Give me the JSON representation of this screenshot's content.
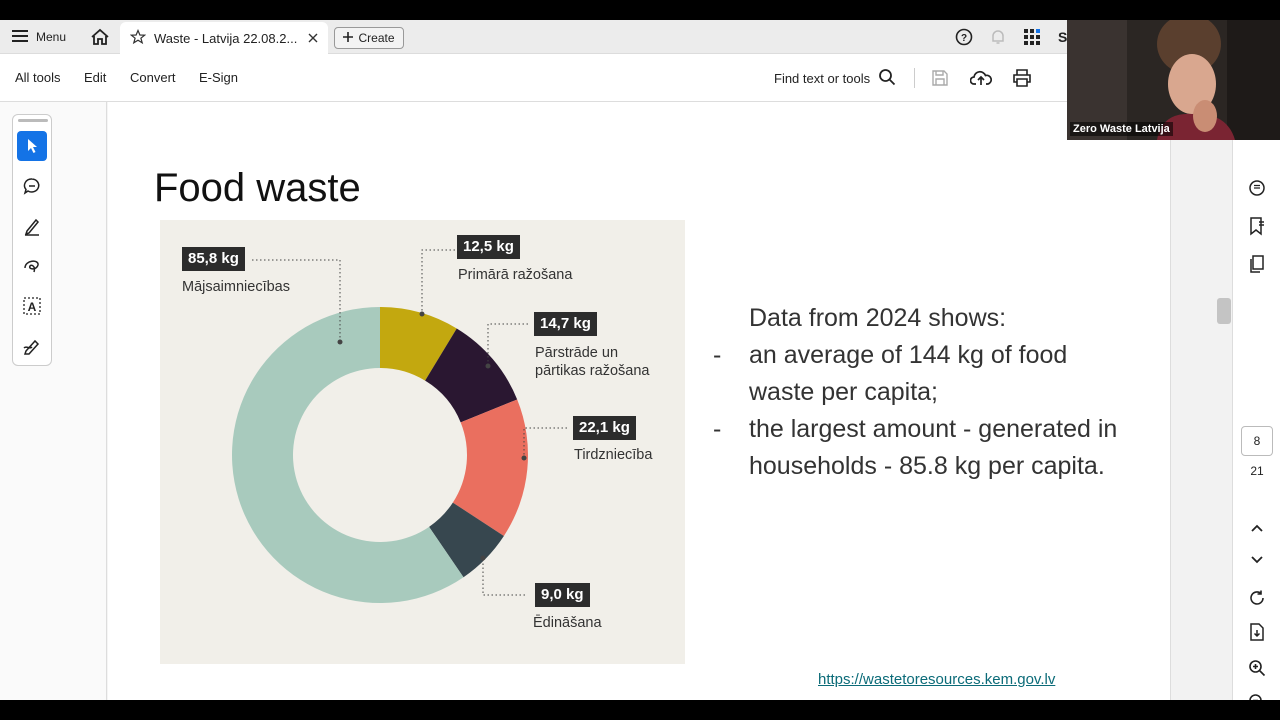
{
  "topbar": {
    "menu_label": "Menu",
    "tab_title": "Waste - Latvija 22.08.2...",
    "create_label": "Create",
    "user_initial": "S"
  },
  "toolbar": {
    "items": [
      "All tools",
      "Edit",
      "Convert",
      "E-Sign"
    ],
    "find_label": "Find text or tools"
  },
  "slide": {
    "title": "Food waste",
    "intro": "Data from 2024 shows:",
    "bullets": [
      "an average of 144 kg of food waste per capita;",
      "the largest amount - generated in households - 85.8 kg per capita."
    ],
    "link": "https://wastetoresources.kem.gov.lv"
  },
  "chart_data": {
    "type": "pie",
    "variant": "donut",
    "unit": "kg",
    "slices": [
      {
        "label": "Mājsaimniecības",
        "value": 85.8,
        "value_label": "85,8 kg",
        "color": "#a8cabd"
      },
      {
        "label": "Primārā ražošana",
        "value": 12.5,
        "value_label": "12,5 kg",
        "color": "#c3a80f"
      },
      {
        "label": "Pārstrāde un pārtikas ražošana",
        "value": 14.7,
        "value_label": "14,7 kg",
        "color": "#2a1731"
      },
      {
        "label": "Tirdzniecība",
        "value": 22.1,
        "value_label": "22,1 kg",
        "color": "#ea6f5f"
      },
      {
        "label": "Ēdināšana",
        "value": 9.0,
        "value_label": "9,0 kg",
        "color": "#37474f"
      }
    ]
  },
  "chart_labels": {
    "l1a": "Pārstrāde un",
    "l1b": "pārtikas ražošana"
  },
  "page_nav": {
    "current": "8",
    "total": "21"
  },
  "video": {
    "participant": "Zero Waste Latvija"
  }
}
